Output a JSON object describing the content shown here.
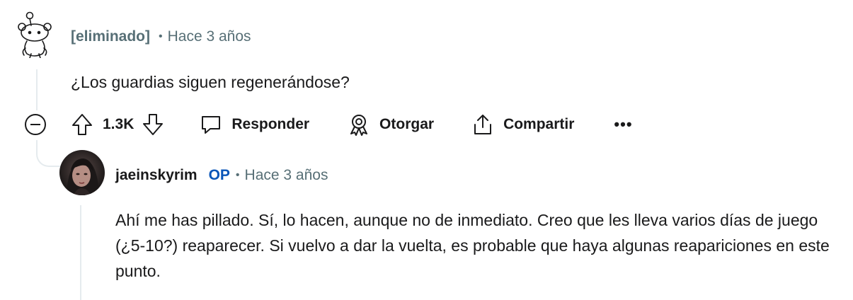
{
  "comment": {
    "author": "[eliminado]",
    "separator": "•",
    "time": "Hace 3 años",
    "body": "¿Los guardias siguen regenerándose?",
    "avatar_icon": "deleted-user-snoo-icon"
  },
  "actions": {
    "score": "1.3K",
    "reply_label": "Responder",
    "award_label": "Otorgar",
    "share_label": "Compartir",
    "more_label": "•••",
    "collapse_icon": "minus-circle-icon",
    "upvote_icon": "arrow-up-icon",
    "downvote_icon": "arrow-down-icon",
    "reply_icon": "speech-bubble-icon",
    "award_icon": "award-ribbon-icon",
    "share_icon": "share-upload-icon"
  },
  "reply": {
    "author": "jaeinskyrim",
    "op_badge": "OP",
    "separator": "•",
    "time": "Hace 3 años",
    "body": "Ahí me has pillado. Sí, lo hacen, aunque no de inmediato. Creo que les lleva varios días de juego (¿5-10?) reaparecer. Si vuelvo a dar la vuelta, es probable que haya algunas reapariciones en este punto.",
    "avatar_icon": "user-avatar-photo"
  },
  "colors": {
    "meta_gray": "#576f76",
    "op_blue": "#0a56b8",
    "text": "#1a1a1b",
    "thread_line": "#e5ebee"
  }
}
